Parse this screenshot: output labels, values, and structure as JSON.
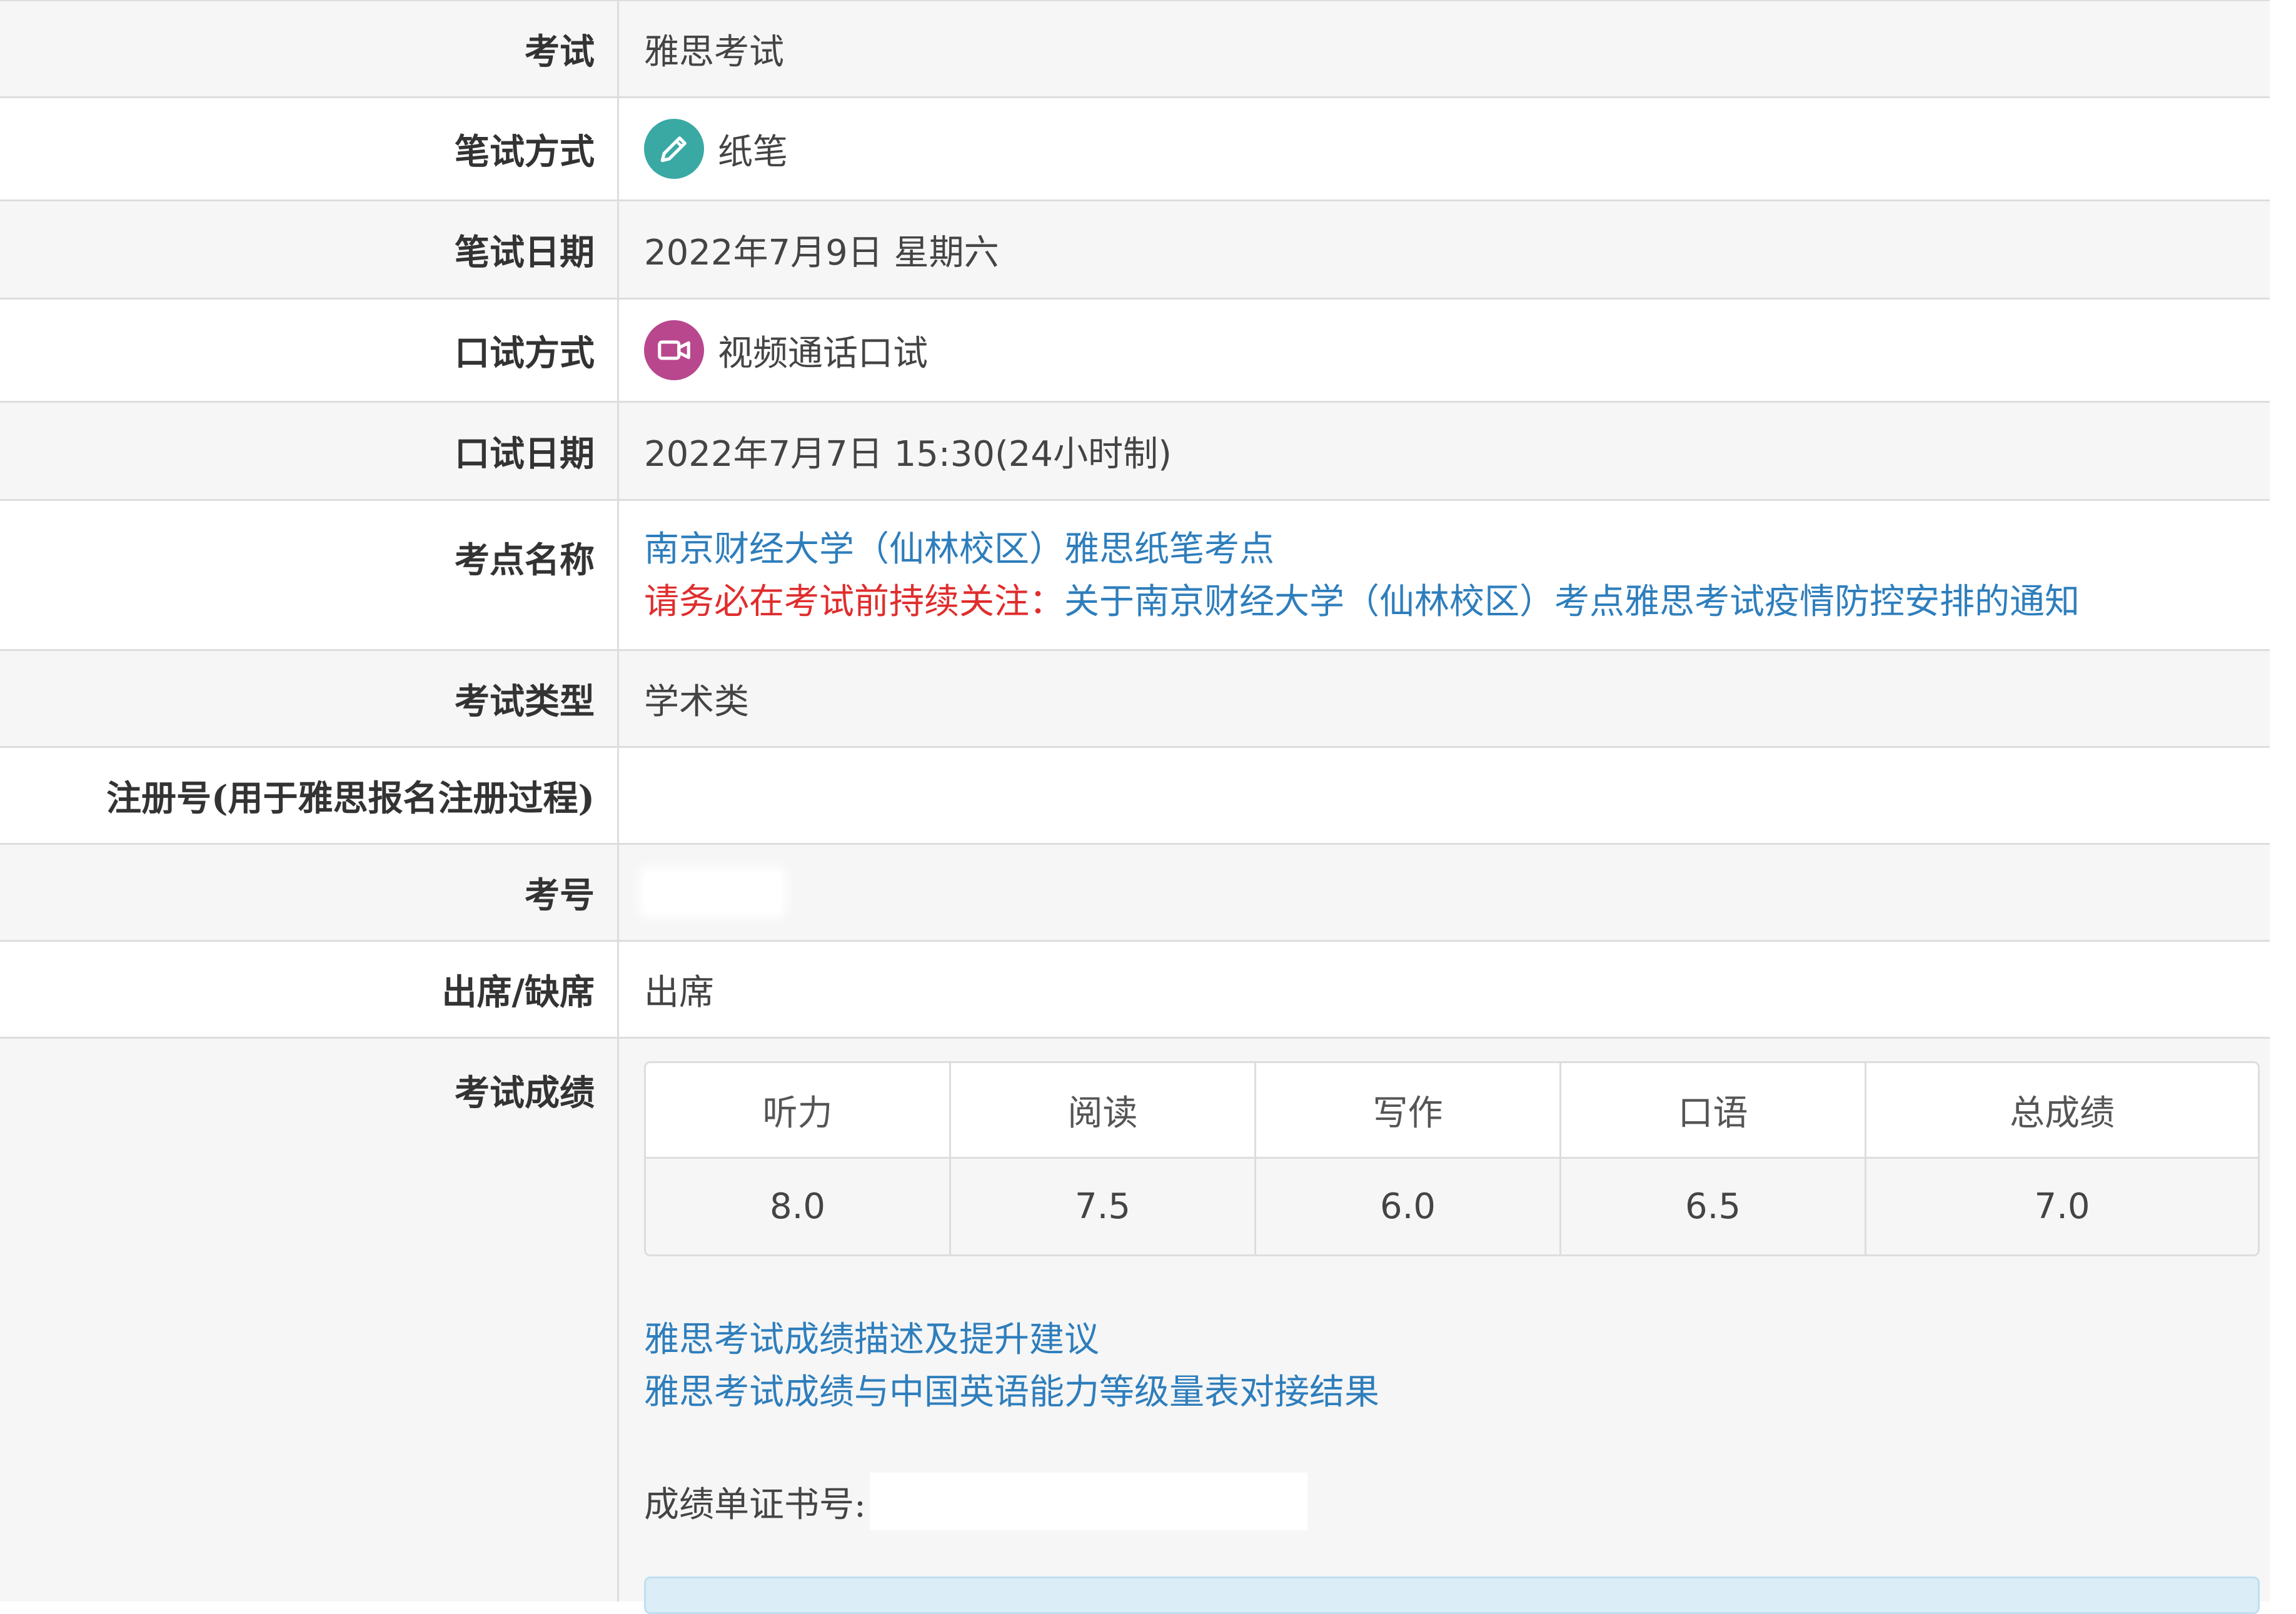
{
  "rows": {
    "exam": {
      "label": "考试",
      "value": "雅思考试"
    },
    "written_mode": {
      "label": "笔试方式",
      "value": "纸笔",
      "icon": "pencil-icon",
      "icon_color": "#3aa9a4"
    },
    "written_date": {
      "label": "笔试日期",
      "value": "2022年7月9日 星期六"
    },
    "speaking_mode": {
      "label": "口试方式",
      "value": "视频通话口试",
      "icon": "video-camera-icon",
      "icon_color": "#b9478e"
    },
    "speaking_date": {
      "label": "口试日期",
      "value": "2022年7月7日 15:30(24小时制)"
    },
    "venue": {
      "label": "考点名称",
      "name_link": "南京财经大学（仙林校区）雅思纸笔考点",
      "notice_prefix": "请务必在考试前持续关注：",
      "notice_link": "关于南京财经大学（仙林校区）考点雅思考试疫情防控安排的通知"
    },
    "exam_type": {
      "label": "考试类型",
      "value": "学术类"
    },
    "registration_no": {
      "label": "注册号(用于雅思报名注册过程)",
      "value": ""
    },
    "candidate_no": {
      "label": "考号",
      "value": ""
    },
    "attendance": {
      "label": "出席/缺席",
      "value": "出席"
    },
    "results": {
      "label": "考试成绩"
    }
  },
  "scores": {
    "headers": [
      "听力",
      "阅读",
      "写作",
      "口语",
      "总成绩"
    ],
    "values": [
      "8.0",
      "7.5",
      "6.0",
      "6.5",
      "7.0"
    ]
  },
  "result_links": [
    "雅思考试成绩描述及提升建议",
    "雅思考试成绩与中国英语能力等级量表对接结果"
  ],
  "certificate": {
    "label": "成绩单证书号:",
    "value": ""
  },
  "colors": {
    "link": "#2e7ebc",
    "warning": "#e02d2d",
    "row_alt": "#f6f6f6",
    "border": "#dddddd"
  }
}
